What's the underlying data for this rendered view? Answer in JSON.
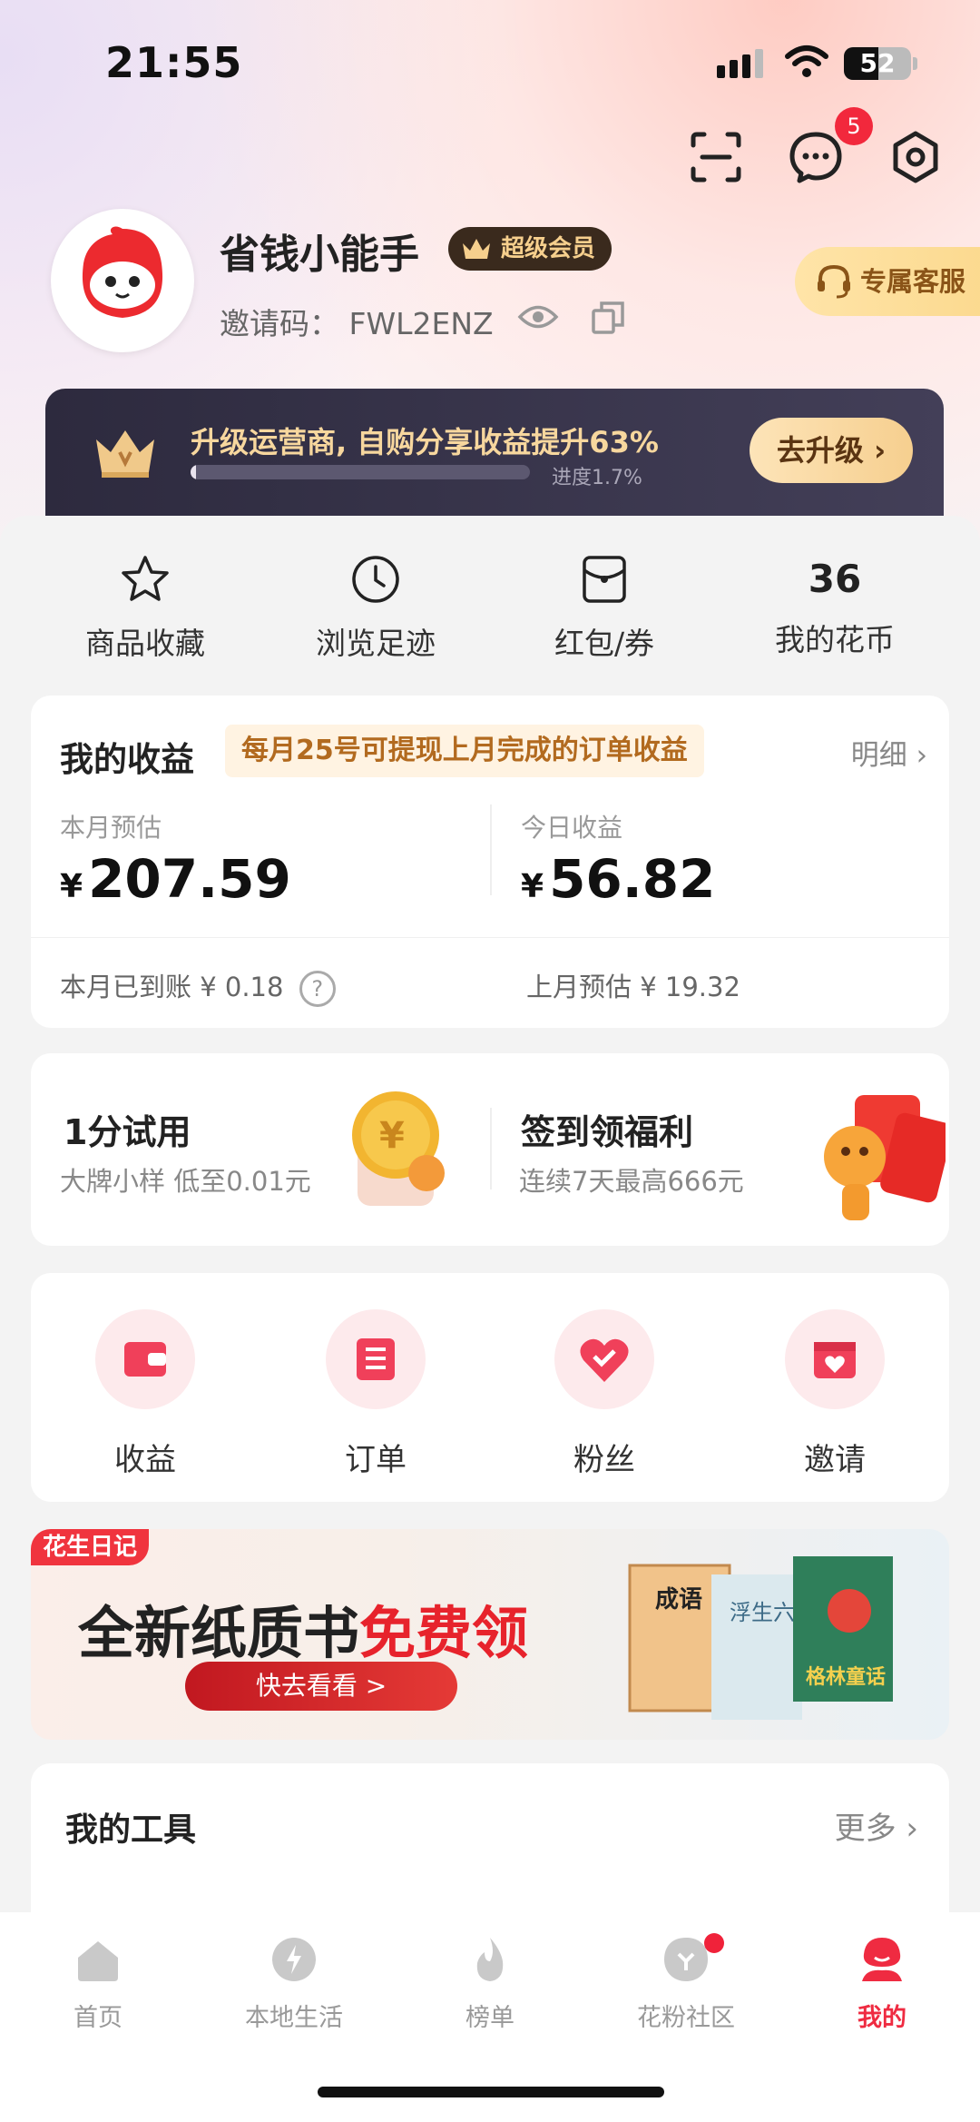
{
  "status": {
    "time": "21:55",
    "battery": "52",
    "battery_level": 0.52
  },
  "header": {
    "message_badge": "5"
  },
  "profile": {
    "name": "省钱小能手",
    "vip_label": "超级会员",
    "invite_label": "邀请码：",
    "invite_code": "FWL2ENZ",
    "service_label": "专属客服"
  },
  "upgrade": {
    "title": "升级运营商, 自购分享收益提升63%",
    "progress_text": "进度1.7%",
    "progress": 0.017,
    "button": "去升级"
  },
  "quick": [
    {
      "label": "商品收藏",
      "icon": "star-icon"
    },
    {
      "label": "浏览足迹",
      "icon": "clock-icon"
    },
    {
      "label": "红包/券",
      "icon": "coupon-icon"
    },
    {
      "label": "我的花币",
      "value": "36"
    }
  ],
  "earnings": {
    "title": "我的收益",
    "tip": "每月25号可提现上月完成的订单收益",
    "detail": "明细",
    "currency": "¥",
    "month_label": "本月预估",
    "month_value": "207.59",
    "today_label": "今日收益",
    "today_value": "56.82",
    "arrived_label": "本月已到账 ¥ 0.18",
    "last_month_label": "上月预估 ¥ 19.32"
  },
  "promos": [
    {
      "title": "1分试用",
      "subtitle": "大牌小样 低至0.01元"
    },
    {
      "title": "签到领福利",
      "subtitle": "连续7天最高666元"
    }
  ],
  "entries": [
    {
      "label": "收益"
    },
    {
      "label": "订单"
    },
    {
      "label": "粉丝"
    },
    {
      "label": "邀请"
    }
  ],
  "banner": {
    "tag": "花生日记",
    "title_a": "全新纸质书",
    "title_b": "免费领",
    "button": "快去看看 >",
    "book_1": "成语",
    "book_2": "浮生六记",
    "book_3": "格林童话"
  },
  "tools": {
    "title": "我的工具",
    "more": "更多"
  },
  "tabs": [
    {
      "label": "首页"
    },
    {
      "label": "本地生活"
    },
    {
      "label": "榜单"
    },
    {
      "label": "花粉社区"
    },
    {
      "label": "我的"
    }
  ],
  "colors": {
    "accent": "#ef2b41",
    "gold": "#f7d79e",
    "dark_banner": "#2d2a3e"
  }
}
